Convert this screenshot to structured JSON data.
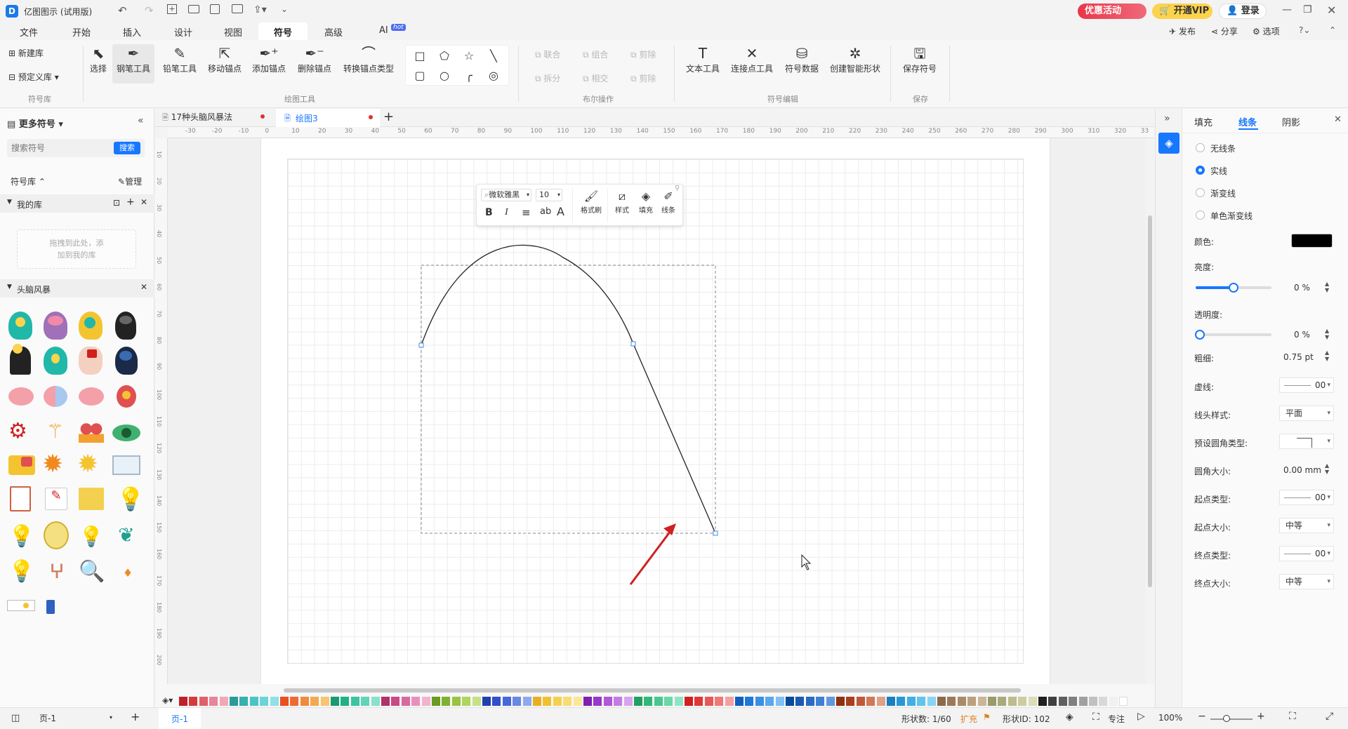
{
  "app": {
    "title": "亿图图示 (试用版)",
    "promo_button": "优惠活动",
    "vip_button": "开通VIP",
    "login_button": "登录",
    "publish": "发布",
    "share": "分享",
    "options": "选项"
  },
  "menu": {
    "items": [
      "文件",
      "开始",
      "插入",
      "设计",
      "视图",
      "符号",
      "高级",
      "AI"
    ],
    "active": "符号",
    "hot_badge": "hot"
  },
  "ribbon": {
    "new_lib": "新建库",
    "predef_lib": "预定义库",
    "group_symbol_lib": "符号库",
    "select": "选择",
    "pen_tool": "钢笔工具",
    "pencil_tool": "铅笔工具",
    "move_anchor": "移动锚点",
    "add_anchor": "添加锚点",
    "delete_anchor": "删除锚点",
    "convert_anchor": "转换锚点类型",
    "group_draw_tools": "绘图工具",
    "union": "联合",
    "combine": "组合",
    "subtract": "剪除",
    "split": "拆分",
    "intersect": "相交",
    "subtract2": "剪除",
    "group_boolean": "布尔操作",
    "text_tool": "文本工具",
    "connect_tool": "连接点工具",
    "symbol_data": "符号数据",
    "smart_shape": "创建智能形状",
    "group_symbol_edit": "符号编辑",
    "save_symbol": "保存符号",
    "group_save": "保存"
  },
  "left_panel": {
    "more_symbols": "更多符号",
    "search_placeholder": "搜索符号",
    "search_button": "搜索",
    "symbol_lib": "符号库",
    "manage": "管理",
    "my_library": "我的库",
    "drop_hint_1": "拖拽到此处，添",
    "drop_hint_2": "加到我的库",
    "brainstorm": "头脑风暴"
  },
  "tabs": [
    {
      "label": "17种头脑风暴法",
      "active": false
    },
    {
      "label": "绘图3",
      "active": true
    }
  ],
  "ruler_top": [
    "-30",
    "-20",
    "-10",
    "0",
    "10",
    "20",
    "30",
    "40",
    "50",
    "60",
    "70",
    "80",
    "90",
    "100",
    "110",
    "120",
    "130",
    "140",
    "150",
    "160",
    "170",
    "180",
    "190",
    "200",
    "210",
    "220",
    "230",
    "240",
    "250",
    "260",
    "270",
    "280",
    "290",
    "300",
    "310",
    "320",
    "33"
  ],
  "ruler_left": [
    "10",
    "20",
    "30",
    "40",
    "50",
    "60",
    "70",
    "80",
    "90",
    "100",
    "110",
    "120",
    "130",
    "140",
    "150",
    "160",
    "170",
    "180",
    "190",
    "200"
  ],
  "float_toolbar": {
    "font": "微软雅黑",
    "size": "10",
    "bold": "B",
    "italic": "I",
    "align": "≡",
    "ab": "ab",
    "font_color": "A",
    "format_brush": "格式刷",
    "style": "样式",
    "fill": "填充",
    "line": "线条"
  },
  "right_panel": {
    "tab_fill": "填充",
    "tab_line": "线条",
    "tab_shadow": "阴影",
    "active_tab": "线条",
    "opt_none": "无线条",
    "opt_solid": "实线",
    "opt_gradient": "渐变线",
    "opt_mono_gradient": "单色渐变线",
    "color_label": "颜色:",
    "color_value": "#000000",
    "brightness_label": "亮度:",
    "brightness_value": "0 %",
    "transparency_label": "透明度:",
    "transparency_value": "0 %",
    "weight_label": "粗细:",
    "weight_value": "0.75 pt",
    "dash_label": "虚线:",
    "dash_value": "00",
    "cap_label": "线头样式:",
    "cap_value": "平面",
    "corner_type_label": "预设圆角类型:",
    "corner_size_label": "圆角大小:",
    "corner_size_value": "0.00 mm",
    "start_type_label": "起点类型:",
    "start_type_value": "00",
    "start_size_label": "起点大小:",
    "start_size_value": "中等",
    "end_type_label": "终点类型:",
    "end_type_value": "00",
    "end_size_label": "终点大小:",
    "end_size_value": "中等"
  },
  "status": {
    "page_select": "页-1",
    "page_tab": "页-1",
    "shape_count": "形状数: 1/60",
    "expand": "扩充",
    "shape_id": "形状ID: 102",
    "focus": "专注",
    "zoom": "100%"
  },
  "palette": [
    "#c0202a",
    "#d63b3b",
    "#e0606a",
    "#e8859a",
    "#f0a8b8",
    "#2a9a9a",
    "#36b0b0",
    "#4bc4c4",
    "#6ad4d8",
    "#8fe0e8",
    "#e85020",
    "#f06a30",
    "#f08a40",
    "#f4a850",
    "#f8c470",
    "#1a9a70",
    "#22b088",
    "#3cc4a0",
    "#60d4b8",
    "#8ae0c8",
    "#b0306a",
    "#c84888",
    "#d868a0",
    "#e890bc",
    "#f0b4d0",
    "#6a9a20",
    "#80b030",
    "#98c440",
    "#b0d460",
    "#c8e088",
    "#2040b0",
    "#3050c8",
    "#4868d8",
    "#6888e4",
    "#90a8ee",
    "#e8b020",
    "#f0c030",
    "#f4d050",
    "#f8dc70",
    "#fae898",
    "#8020b0",
    "#9838c8",
    "#b058d8",
    "#c47ce4",
    "#d8a4ee",
    "#20a060",
    "#30b878",
    "#48c890",
    "#68d8a8",
    "#90e4c4",
    "#d02020",
    "#e03838",
    "#e85858",
    "#f07878",
    "#f4a0a0",
    "#1060c0",
    "#2078d8",
    "#3890e4",
    "#58a8ee",
    "#80c0f4",
    "#0a4a9a",
    "#1a5ab0",
    "#2a6ac4",
    "#4080d4",
    "#6098e0",
    "#903010",
    "#a84020",
    "#c05838",
    "#d07858",
    "#e0a088",
    "#1880c0",
    "#2898d4",
    "#40b0e4",
    "#60c4ec",
    "#88d4f4",
    "#8a6a4a",
    "#9a7a5a",
    "#aa8a6a",
    "#bca07e",
    "#ccb496",
    "#9a9a6a",
    "#aaaa7a",
    "#bcbc8c",
    "#cccca0",
    "#dcdcb8",
    "#202020",
    "#404040",
    "#606060",
    "#808080",
    "#a0a0a0",
    "#c0c0c0",
    "#d8d8d8",
    "#f0f0f0",
    "#ffffff"
  ]
}
